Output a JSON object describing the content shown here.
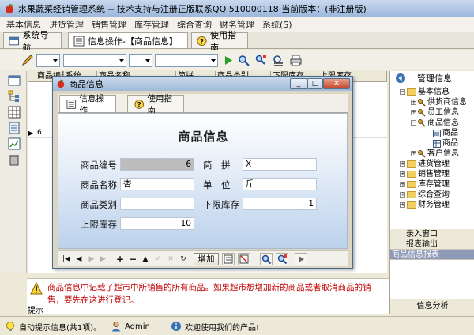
{
  "window": {
    "title": "水果蔬菜经销管理系统 -- 技术支持与注册正版联系QQ 510000118    当前版本：(非注册版)"
  },
  "menu": [
    "基本信息",
    "进货管理",
    "销售管理",
    "库存管理",
    "综合查询",
    "财务管理",
    "系统(S)"
  ],
  "main_tabs": [
    {
      "label": "系统导航"
    },
    {
      "label": "信息操作-【商品信息】"
    },
    {
      "label": "使用指南"
    }
  ],
  "grid": {
    "columns": [
      "商品编号",
      "系统",
      "商品名称",
      "简拼",
      "商品类别",
      "下限库存",
      "上限库存"
    ],
    "row_marker": "▶",
    "row_value": "6"
  },
  "dialog": {
    "title": "商品信息",
    "tabs": [
      "信息操作",
      "使用指南"
    ],
    "form_title": "商品信息",
    "fields": {
      "code_label": "商品编号",
      "code_value": "6",
      "pinyin_label": "简　拼",
      "pinyin_value": "X",
      "name_label": "商品名称",
      "name_value": "杏",
      "unit_label": "单　位",
      "unit_value": "斤",
      "category_label": "商品类别",
      "category_value": "",
      "min_label": "下限库存",
      "min_value": "1",
      "max_label": "上限库存",
      "max_value": "10"
    },
    "nav": {
      "first": "|◀",
      "prev": "◀",
      "next": "▶",
      "last": "▶|",
      "insert": "+",
      "delete": "−",
      "up": "▲",
      "check": "✓",
      "cancel": "✕",
      "refresh": "↻",
      "add_label": "增加"
    }
  },
  "right_panel": {
    "header": "管理信息",
    "tree": [
      {
        "label": "基本信息",
        "level": 0,
        "expander": "−"
      },
      {
        "label": "供货商信息",
        "level": 1,
        "expander": "+"
      },
      {
        "label": "员工信息",
        "level": 1,
        "expander": "+"
      },
      {
        "label": "商品信息",
        "level": 1,
        "expander": "−"
      },
      {
        "label": "商品",
        "level": 2,
        "expander": ""
      },
      {
        "label": "商品",
        "level": 2,
        "expander": ""
      },
      {
        "label": "客户信息",
        "level": 1,
        "expander": "+"
      },
      {
        "label": "进货管理",
        "level": 0,
        "expander": "+"
      },
      {
        "label": "销售管理",
        "level": 0,
        "expander": "+"
      },
      {
        "label": "库存管理",
        "level": 0,
        "expander": "+"
      },
      {
        "label": "综合查询",
        "level": 0,
        "expander": "+"
      },
      {
        "label": "财务管理",
        "level": 0,
        "expander": "+"
      }
    ],
    "links": [
      "录入窗口",
      "报表输出",
      "商品信息报表"
    ],
    "bottom": "信息分析"
  },
  "hint": {
    "label": "提示",
    "text": "商品信息中记载了超市中所销售的所有商品。如果超市想增加新的商品或者取消商品的销售，要先在这进行登记。"
  },
  "status": {
    "auto_hint": "自动提示信息(共1项)。",
    "user": "Admin",
    "welcome": "欢迎使用我们的产品!"
  },
  "colors": {
    "hint_text": "#c00000",
    "selected_link": "#8f9ab8"
  }
}
